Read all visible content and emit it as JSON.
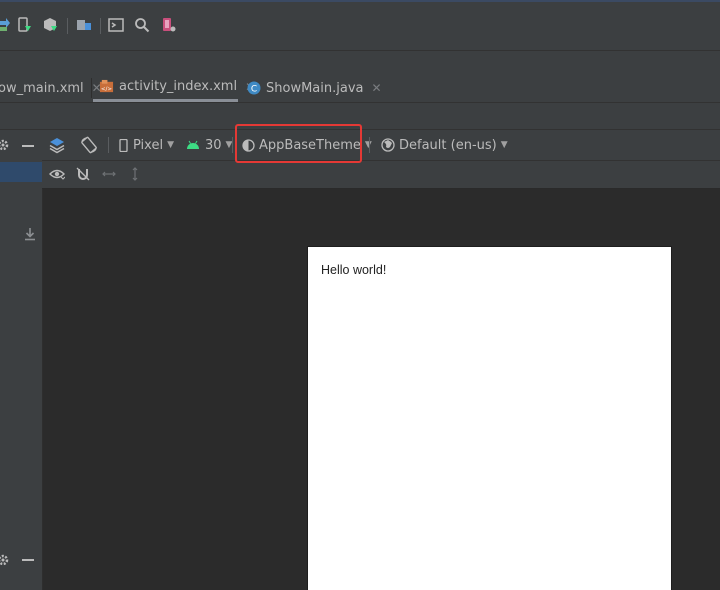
{
  "toolbar": {
    "icons": [
      "sync-gradle-icon",
      "device-file-explorer-icon",
      "sdk-manager-icon",
      "project-structure-icon",
      "terminal-icon",
      "search-icon",
      "device-manager-icon"
    ]
  },
  "tabs": [
    {
      "label": "ow_main.xml",
      "active": false
    },
    {
      "label": "activity_index.xml",
      "active": true
    },
    {
      "label": "ShowMain.java",
      "active": false
    }
  ],
  "design_toolbar": {
    "device": "Pixel",
    "api_level": "30",
    "theme": "AppBaseTheme",
    "locale": "Default (en-us)"
  },
  "preview": {
    "text": "Hello world!"
  },
  "colors": {
    "highlight": "#e53935",
    "android_green": "#3ddc84",
    "accent_blue": "#4a90d9"
  }
}
